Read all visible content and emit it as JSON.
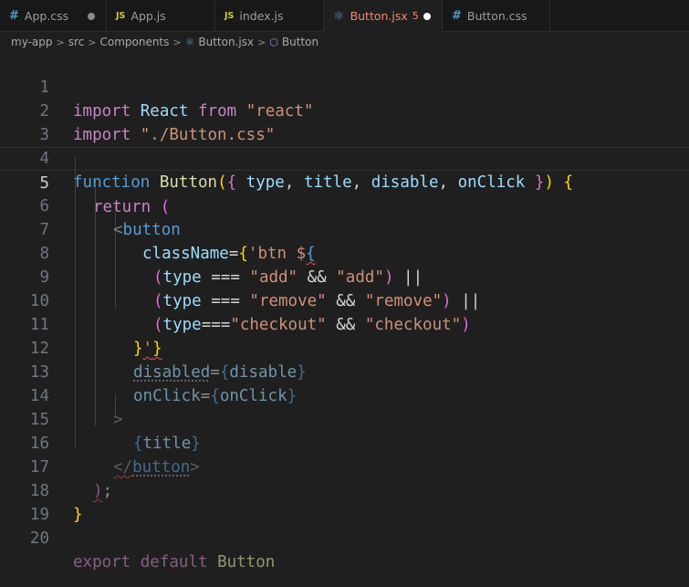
{
  "tabs": [
    {
      "icon": "#",
      "label": "App.css",
      "state": "modified"
    },
    {
      "icon": "JS",
      "label": "App.js",
      "state": ""
    },
    {
      "icon": "JS",
      "label": "index.js",
      "state": ""
    },
    {
      "icon": "⚛",
      "label": "Button.jsx",
      "problems": "5",
      "state": "active-modified"
    },
    {
      "icon": "#",
      "label": "Button.css",
      "state": ""
    }
  ],
  "breadcrumb": [
    "my-app",
    "src",
    "Components",
    "Button.jsx",
    "Button"
  ],
  "line_numbers": [
    "1",
    "2",
    "3",
    "4",
    "5",
    "6",
    "7",
    "8",
    "9",
    "10",
    "11",
    "12",
    "13",
    "14",
    "15",
    "16",
    "17",
    "18",
    "19",
    "20"
  ],
  "code": {
    "l1": {
      "import": "import",
      "name": "React",
      "from": "from",
      "src": "\"react\""
    },
    "l2": {
      "import": "import",
      "src": "\"./Button.css\""
    },
    "l4": {
      "function": "function",
      "name": "Button",
      "p1": "type",
      "p2": "title",
      "p3": "disable",
      "p4": "onClick"
    },
    "l5": {
      "return": "return"
    },
    "l6": {
      "tag": "button"
    },
    "l7": {
      "attr": "className",
      "tpl": "'btn $"
    },
    "l8": {
      "var": "type",
      "op": "===",
      "s1": "\"add\"",
      "and": "&&",
      "s2": "\"add\"",
      "or": "||"
    },
    "l9": {
      "var": "type",
      "op": "===",
      "s1": "\"remove\"",
      "and": "&&",
      "s2": "\"remove\"",
      "or": "||"
    },
    "l10": {
      "var": "type",
      "op": "===",
      "s1": "\"checkout\"",
      "and": "&&",
      "s2": "\"checkout\""
    },
    "l12": {
      "attr": "disabled",
      "val": "disable"
    },
    "l13": {
      "attr": "onClick",
      "val": "onClick"
    },
    "l15": {
      "val": "title"
    },
    "l16": {
      "tag": "button"
    },
    "l20": {
      "export": "export",
      "default": "default",
      "name": "Button"
    }
  }
}
